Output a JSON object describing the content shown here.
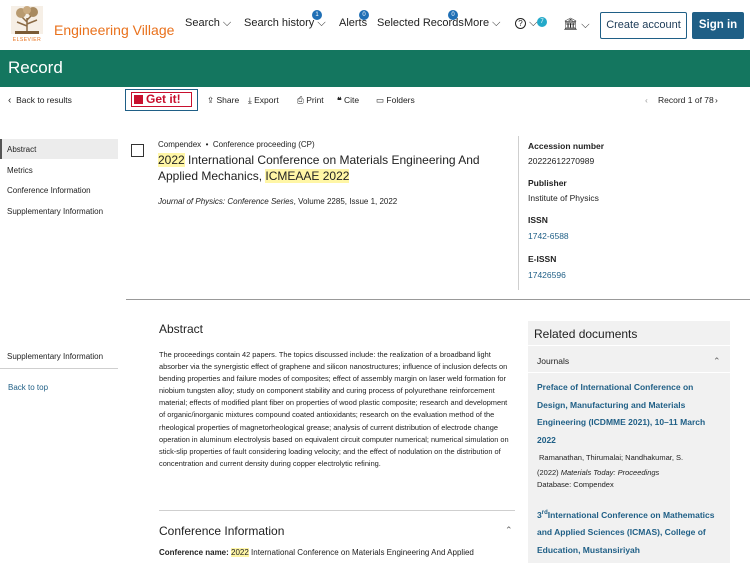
{
  "header": {
    "logo_text": "ELSEVIER",
    "brand": "Engineering Village",
    "nav": {
      "search": "Search",
      "search_history": "Search history",
      "search_history_badge": "1",
      "alerts": "Alerts",
      "alerts_badge": "0",
      "selected_records": "Selected Records",
      "selected_records_badge": "0",
      "more": "More",
      "help_badge": "7"
    },
    "create_account": "Create account",
    "sign_in": "Sign in"
  },
  "record_bar": {
    "title": "Record"
  },
  "toolbar": {
    "back": "Back to results",
    "get_it": "Get it!",
    "share": "Share",
    "export": "Export",
    "print": "Print",
    "cite": "Cite",
    "folders": "Folders",
    "record_counter": "Record 1 of 78"
  },
  "sidebar": {
    "items": [
      "Abstract",
      "Metrics",
      "Conference Information",
      "Supplementary Information"
    ],
    "bottom_item": "Supplementary Information",
    "back_to_top": "Back to top"
  },
  "record": {
    "database": "Compendex",
    "doc_type": "Conference proceeding (CP)",
    "title_hl1": "2022",
    "title_mid": " International Conference on Materials Engineering And Applied Mechanics, ",
    "title_hl2": "ICMEAAE 2022",
    "journal": "Journal of Physics: Conference Series",
    "journal_rest": ", Volume 2285, Issue 1, 2022"
  },
  "details": {
    "accession_label": "Accession number",
    "accession_value": "20222612270989",
    "publisher_label": "Publisher",
    "publisher_value": "Institute of Physics",
    "issn_label": "ISSN",
    "issn_value": "1742-6588",
    "eissn_label": "E-ISSN",
    "eissn_value": "17426596"
  },
  "abstract": {
    "heading": "Abstract",
    "text": "The proceedings contain 42 papers. The topics discussed include: the realization of a broadband light absorber via the synergistic effect of graphene and silicon nanostructures; influence of inclusion defects on bending properties and failure modes of composites; effect of assembly margin on laser weld formation for niobium tungsten alloy; study on component stability and curing process of polyurethane reinforcement material; effects of modified plant fiber on properties of wood plastic composite; research and development of organic/inorganic mixtures compound coated antioxidants; research on the evaluation method of the rheological properties of magnetorheological grease; analysis of current distribution of electrode change operation in aluminum electrolysis based on equivalent circuit computer numerical; numerical simulation on stick-slip properties of fault considering loading velocity; and the effect of nodulation on the distribution of concentration and current density during copper electrolytic refining."
  },
  "conference_info": {
    "heading": "Conference Information",
    "name_label": "Conference name:",
    "name_hl": "2022",
    "name_rest": " International Conference on Materials Engineering And Applied"
  },
  "related": {
    "heading": "Related documents",
    "section": "Journals",
    "doc1_title": "Preface of International Conference on Design, Manufacturing and Materials Engineering (ICDMME 2021), 10–11 March 2022",
    "doc1_authors": "Ramanathan, Thirumalai; Nandhakumar, S.",
    "doc1_year": "(2022) ",
    "doc1_source": "Materials Today: Proceedings",
    "doc1_db": "Database: Compendex",
    "doc2_num": "3",
    "doc2_sup": "rd",
    "doc2_title": "International Conference on Mathematics and Applied Sciences (ICMAS), College of Education, Mustansiriyah"
  }
}
